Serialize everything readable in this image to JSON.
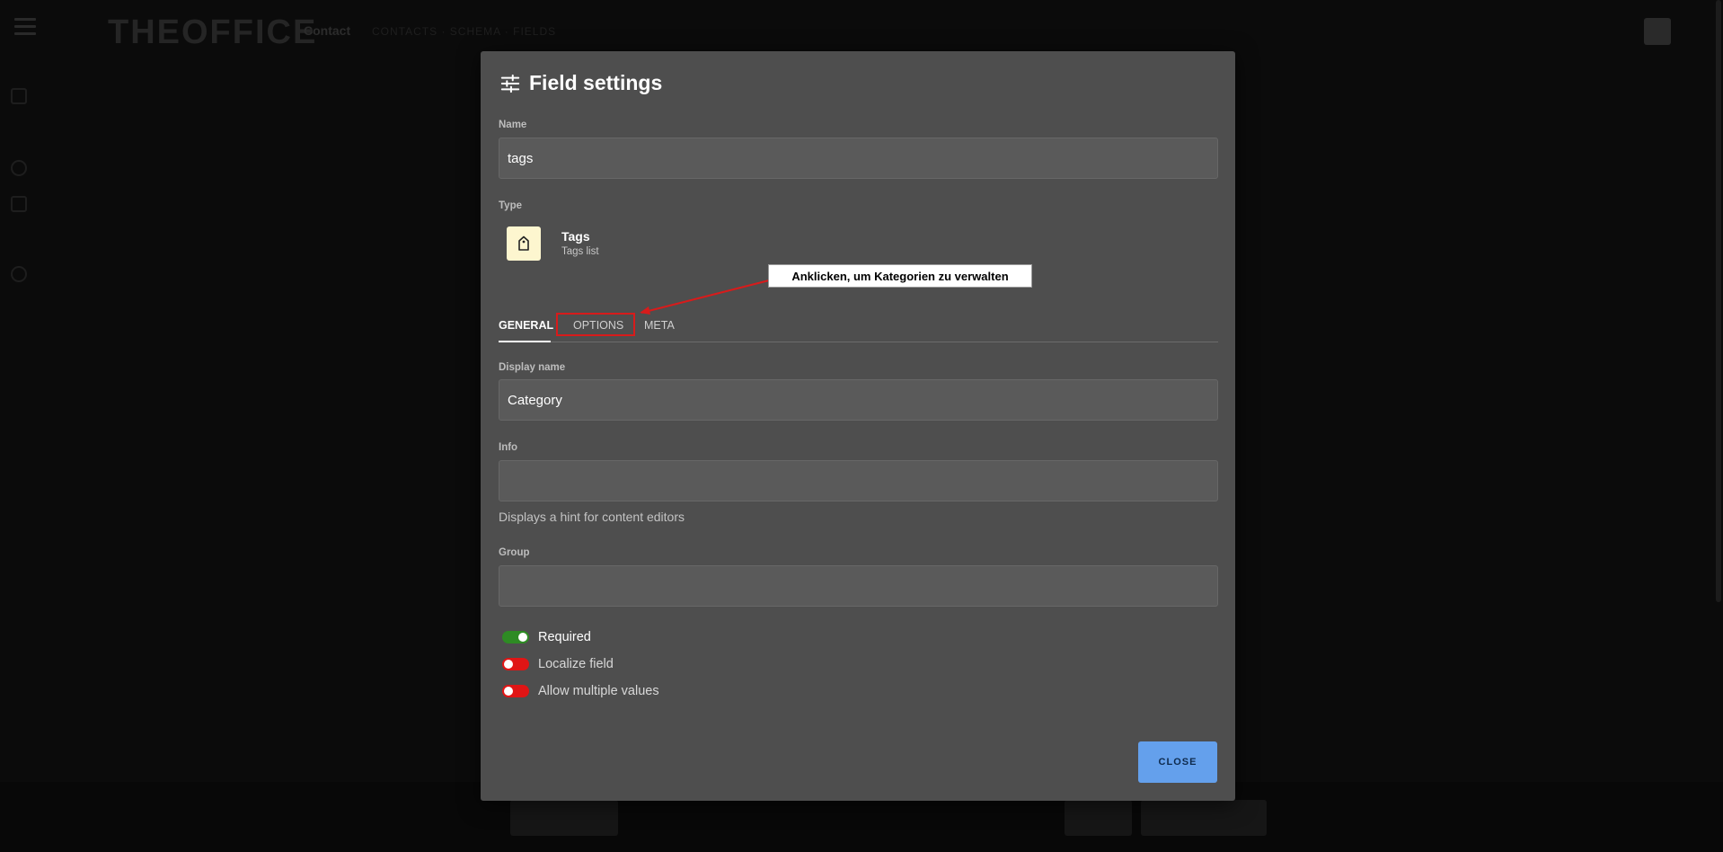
{
  "background": {
    "logo": "THEOFFICE",
    "breadcrumb": "Contact",
    "breadcrumb_path": "CONTACTS · SCHEMA · FIELDS"
  },
  "modal": {
    "title": "Field settings",
    "title_icon": "sliders-icon",
    "name_label": "Name",
    "name_value": "tags",
    "type_label": "Type",
    "type_icon": "tag-icon",
    "type_name": "Tags",
    "type_description": "Tags list",
    "tabs": [
      {
        "label": "GENERAL",
        "active": true
      },
      {
        "label": "OPTIONS",
        "active": false
      },
      {
        "label": "META",
        "active": false
      }
    ],
    "display_name_label": "Display name",
    "display_name_value": "Category",
    "info_label": "Info",
    "info_value": "",
    "info_hint": "Displays a hint for content editors",
    "group_label": "Group",
    "group_value": "",
    "toggles": [
      {
        "label": "Required",
        "on": true
      },
      {
        "label": "Localize field",
        "on": false
      },
      {
        "label": "Allow multiple values",
        "on": false
      }
    ],
    "close_label": "CLOSE"
  },
  "annotation": {
    "callout_text": "Anklicken, um Kategorien zu verwalten"
  },
  "colors": {
    "modal_bg": "#4e4e4e",
    "input_bg": "#5a5a5a",
    "toggle_on": "#2e8b24",
    "toggle_off": "#e01515",
    "close_button": "#64a0ec",
    "type_icon_bg": "#fdf6cf",
    "annotation_red": "#d81b1b"
  }
}
